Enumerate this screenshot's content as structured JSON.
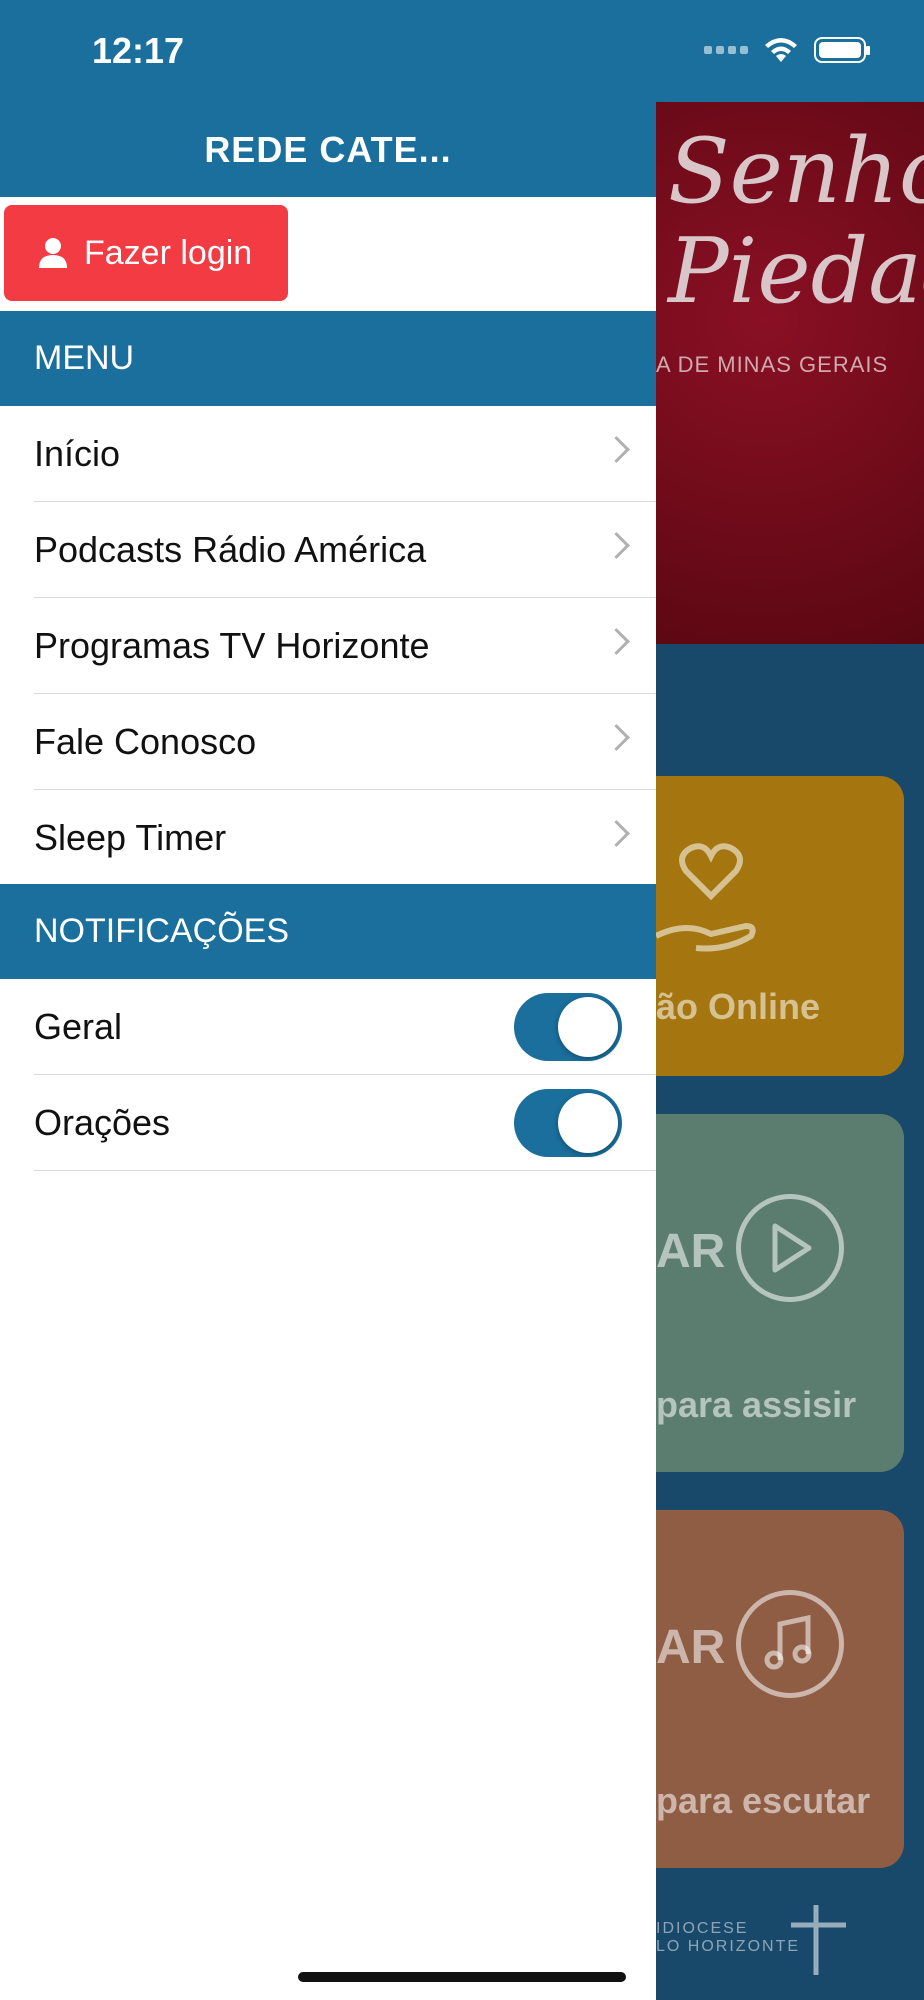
{
  "status_bar": {
    "time": "12:17"
  },
  "drawer": {
    "title": "REDE CATE...",
    "login_label": "Fazer login",
    "menu_header": "MENU",
    "menu_items": [
      {
        "label": "Início"
      },
      {
        "label": "Podcasts Rádio América"
      },
      {
        "label": "Programas TV Horizonte"
      },
      {
        "label": "Fale Conosco"
      },
      {
        "label": "Sleep Timer"
      }
    ],
    "notifications_header": "NOTIFICAÇÕES",
    "notifications": [
      {
        "label": "Geral",
        "enabled": true
      },
      {
        "label": "Orações",
        "enabled": true
      }
    ]
  },
  "background": {
    "hero_title_line1": "Senhora",
    "hero_title_line2": "Piedade",
    "hero_subtitle": "A DE MINAS GERAIS",
    "card1_label": "ão Online",
    "card2_big": "AR",
    "card2_label": "para assisir",
    "card3_big": "AR",
    "card3_label": "para escutar",
    "footer_text": "IDIOCESE",
    "footer_text2": "LO HORIZONTE"
  },
  "colors": {
    "primary": "#1a6f9d",
    "login": "#f23b43"
  }
}
